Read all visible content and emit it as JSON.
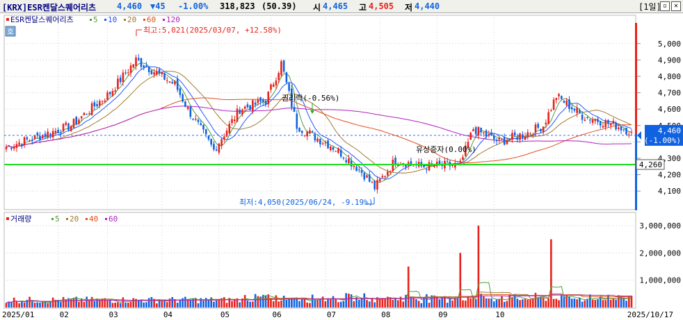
{
  "header": {
    "code_name": "[KRX]ESR켄달스퀘어리츠",
    "price": "4,460",
    "change": "▼45",
    "change_pct": "-1.00%",
    "volume": "318,823",
    "volume_ratio": "(50.39)",
    "open_label": "시",
    "open": "4,465",
    "high_label": "고",
    "high": "4,505",
    "low_label": "저",
    "low": "4,440",
    "period": "[1일]",
    "colors": {
      "up": "#e8211b",
      "down": "#1062e0",
      "title": "#000080"
    }
  },
  "price_panel": {
    "name": "ESR켄달스퀘어리츠",
    "ma_labels": [
      "5",
      "10",
      "20",
      "60",
      "120"
    ],
    "ma_colors": [
      "#4f9c3e",
      "#2255ff",
      "#a07a30",
      "#e0501a",
      "#b020c0"
    ],
    "side_badge": "호",
    "annotations": {
      "high": "최고:5,021(2025/03/07, +12.58%)",
      "low": "최저:4,050(2025/06/24, -9.19%)",
      "right_drop": "권리락(-0.56%)",
      "paid_in": "유상증자(0.00%)"
    },
    "support_line": "4,260",
    "current_box": {
      "price": "4,460",
      "pct": "(-1.00%)"
    },
    "y_ticks": [
      "5,000",
      "4,900",
      "4,800",
      "4,700",
      "4,600",
      "4,500",
      "4,400",
      "4,300",
      "4,200",
      "4,100"
    ]
  },
  "volume_panel": {
    "name": "거래량",
    "ma_labels": [
      "5",
      "20",
      "40",
      "60"
    ],
    "ma_colors": [
      "#4f9c3e",
      "#a07a30",
      "#e0501a",
      "#b020c0"
    ],
    "y_ticks": [
      "3,000,000",
      "2,000,000",
      "1,000,000"
    ]
  },
  "x_labels": [
    "2025/01",
    "02",
    "03",
    "04",
    "05",
    "06",
    "07",
    "08",
    "09",
    "10",
    "2025/10/17"
  ],
  "chart_data": {
    "type": "candlestick",
    "price_ylim": [
      4050,
      5050
    ],
    "volume_ylim": [
      0,
      3000000
    ],
    "support_level": 4260,
    "last_price": 4460,
    "high_point": {
      "value": 5021,
      "date": "2025/03/07"
    },
    "low_point": {
      "value": 4050,
      "date": "2025/06/24"
    },
    "keypoints": [
      [
        0,
        4370
      ],
      [
        10,
        4420
      ],
      [
        25,
        4500
      ],
      [
        40,
        4700
      ],
      [
        50,
        4900
      ],
      [
        55,
        4850
      ],
      [
        65,
        4750
      ],
      [
        70,
        4600
      ],
      [
        80,
        4350
      ],
      [
        90,
        4600
      ],
      [
        100,
        4650
      ],
      [
        106,
        4880
      ],
      [
        112,
        4500
      ],
      [
        120,
        4420
      ],
      [
        125,
        4380
      ],
      [
        130,
        4320
      ],
      [
        138,
        4200
      ],
      [
        142,
        4120
      ],
      [
        150,
        4290
      ],
      [
        160,
        4250
      ],
      [
        175,
        4260
      ],
      [
        180,
        4480
      ],
      [
        190,
        4400
      ],
      [
        200,
        4450
      ],
      [
        207,
        4500
      ],
      [
        212,
        4680
      ],
      [
        222,
        4560
      ],
      [
        235,
        4500
      ],
      [
        241,
        4460
      ]
    ],
    "volume_spikes": [
      [
        155,
        1500000
      ],
      [
        175,
        2000000
      ],
      [
        182,
        3000000
      ],
      [
        210,
        2500000
      ]
    ]
  }
}
